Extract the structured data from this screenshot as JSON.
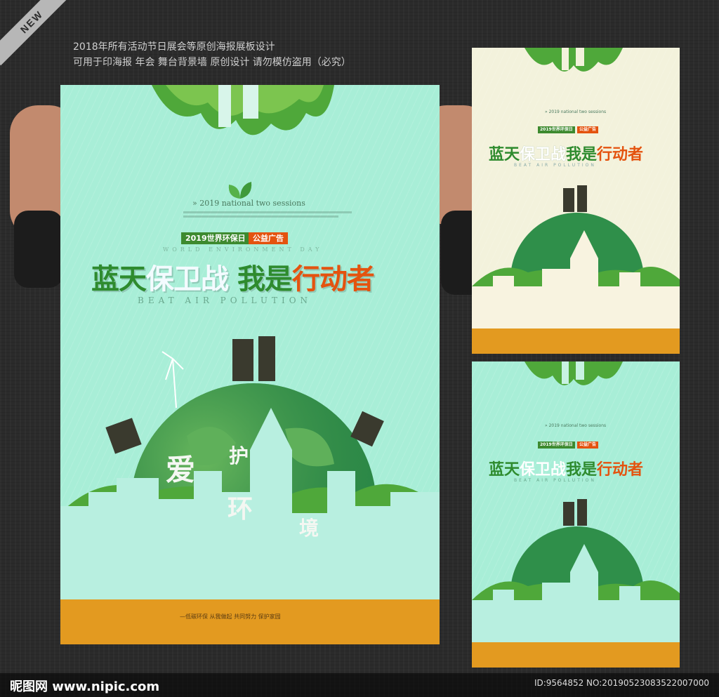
{
  "corner_badge": "NEW",
  "header": {
    "line1": "2018年所有活动节日展会等原创海报展板设计",
    "line2": "可用于印海报  年会  舞台背景墙    原创设计  请勿模仿盗用（必究）"
  },
  "poster": {
    "en_tagline": "» 2019 national two sessions",
    "badge_green": "2019世界环保日",
    "badge_orange": "公益广告",
    "world_env_day": "WORLD ENVIRONMENT DAY",
    "title_part1": "蓝天",
    "title_part2": "保卫战",
    "title_part3": "我是",
    "title_part4": "行动者",
    "subtitle_en": "BEAT AIR POLLUTION",
    "love_char1": "爱",
    "love_char2": "护",
    "love_char3": "环",
    "love_char4": "境",
    "bottom_slogan": "—低碳环保  从我做起  共同努力  保护家园"
  },
  "footer": {
    "logo": "昵图网 www.nipic.com",
    "id_text": "ID:9564852 NO:20190523083522007000"
  },
  "colors": {
    "background": "#2b2b2b",
    "poster_mint": "#a8eed7",
    "leaf_green": "#4fa83a",
    "ground_orange": "#e39a20",
    "title_orange": "#e4530f"
  }
}
